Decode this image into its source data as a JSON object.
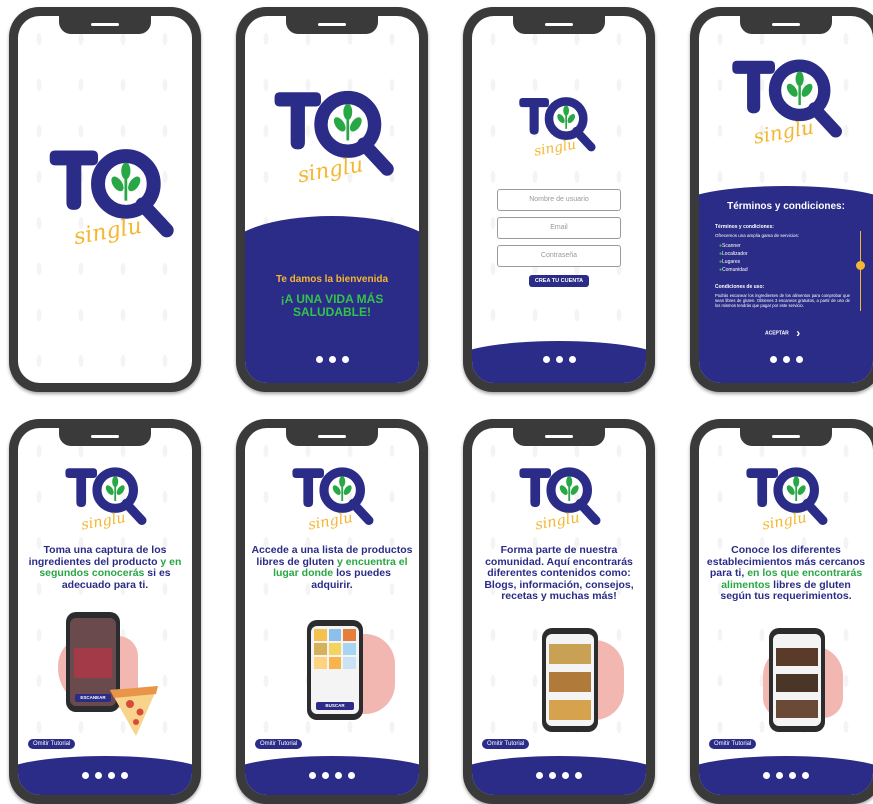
{
  "brand": {
    "letters": "TQ",
    "script": "singlu",
    "navy": "#2b2c87",
    "green": "#28a745",
    "yellow": "#f4b731"
  },
  "screens": {
    "welcome": {
      "title": "Te damos la bienvenida",
      "slogan_line1": "¡A UNA VIDA MÁS",
      "slogan_line2": "SALUDABLE!"
    },
    "signup": {
      "username_placeholder": "Nombre de usuario",
      "email_placeholder": "Email",
      "password_placeholder": "Contraseña",
      "create_label": "CREA TU CUENTA"
    },
    "terms": {
      "heading": "Términos y condiciones:",
      "sub1": "Términos y condiciones:",
      "intro": "Ofrecemos una amplia gama de servicios:",
      "items": [
        "Scanner",
        "Localizador",
        "Lugares",
        "Comunidad"
      ],
      "sub2": "Condiciones de uso:",
      "body": "Podrás escanear los ingredientes de los alimentos para comprobar que sean libres de gluten. Obtienes 3 escaneos gratuitos, a partir de uso de los mismos tendrás que pagar por este servicio.",
      "accept_label": "ACEPTAR"
    },
    "tutorial1": {
      "text_navy": "Toma una captura de los ingredientes del producto",
      "text_green": "y en segundos conocerás",
      "text_navy2": "si es adecuado para ti.",
      "button": "ESCANEAR"
    },
    "tutorial2": {
      "text_navy": "Accede a una lista de productos libres de gluten",
      "text_green": "y encuentra el lugar donde",
      "text_navy2": "los puedes adquirir.",
      "button": "BUSCAR"
    },
    "tutorial3": {
      "text_navy": "Forma parte de nuestra comunidad. Aquí encontrarás diferentes contenidos como: Blogs, información, consejos, recetas y muchas más!"
    },
    "tutorial4": {
      "text_navy": "Conoce los diferentes establecimientos más cercanos para ti,",
      "text_green": "en los que encontrarás alimentos",
      "text_navy2": "libres de gluten según tus requerimientos."
    },
    "omit_label": "Omitir Tutorial"
  }
}
